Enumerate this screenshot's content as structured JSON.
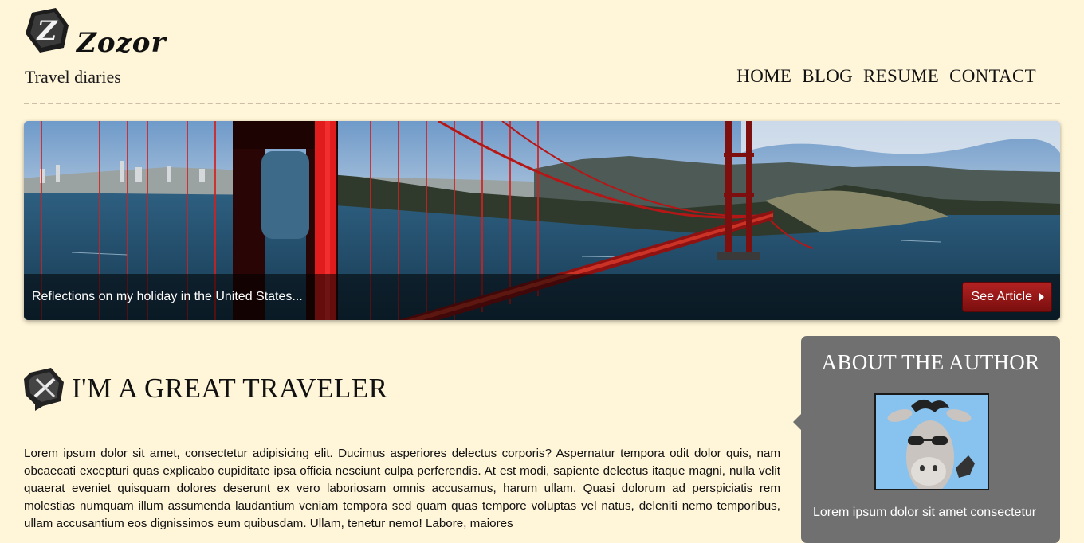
{
  "brand": {
    "name": "Zozor",
    "tagline": "Travel diaries"
  },
  "nav": {
    "items": [
      "HOME",
      "BLOG",
      "RESUME",
      "CONTACT"
    ]
  },
  "hero": {
    "caption": "Reflections on my holiday in the United States...",
    "button_label": "See Article"
  },
  "main": {
    "title": "I'M A GREAT TRAVELER",
    "paragraph": "Lorem ipsum dolor sit amet, consectetur adipisicing elit. Ducimus asperiores delectus corporis? Aspernatur tempora odit dolor quis, nam obcaecati excepturi quas explicabo cupiditate ipsa officia nesciunt culpa perferendis. At est modi, sapiente delectus itaque magni, nulla velit quaerat eveniet quisquam dolores deserunt ex vero laboriosam omnis accusamus, harum ullam. Quasi dolorum ad perspiciatis rem molestias numquam illum assumenda laudantium veniam tempora sed quam quas tempore voluptas vel natus, deleniti nemo temporibus, ullam accusantium eos dignissimos eum quibusdam. Ullam, tenetur nemo! Labore, maiores"
  },
  "sidebar": {
    "title": "ABOUT THE AUTHOR",
    "text": "Lorem ipsum dolor sit amet consectetur"
  },
  "colors": {
    "page_background": "#fff5d8",
    "sidebar_background": "#707070",
    "button_red": "#9e1a1a"
  },
  "icons": [
    "zozor-logo-icon",
    "cutlery-icon",
    "play-arrow-icon"
  ]
}
